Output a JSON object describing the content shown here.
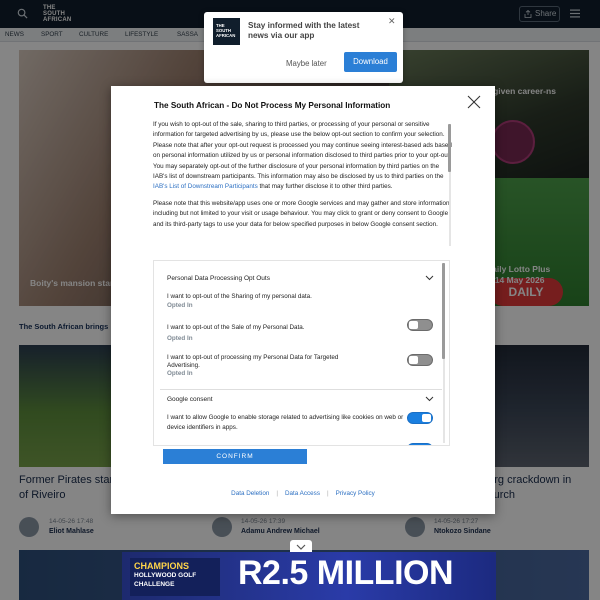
{
  "header": {
    "logo_line1": "THE",
    "logo_line2": "SOUTH",
    "logo_line3": "AFRICAN",
    "share_label": "Share",
    "nav": [
      "NEWS",
      "SPORT",
      "CULTURE",
      "LIFESTYLE",
      "SASSA"
    ]
  },
  "background": {
    "hero_left_caption": "Boity's mansion stars",
    "hero_right_caption": "s given career-ns",
    "lotto_badge": "DAILY LOTTO",
    "hero_right_bottom_caption_1": "Daily Lotto Plus",
    "hero_right_bottom_caption_2": "y, 14 May 2026",
    "bring_text": "The South African brings",
    "cards": [
      {
        "title": "Former Pirates star Ouaddou is doing of Riveiro",
        "time": "14-05-26 17:48",
        "author": "Eliot Mahlase"
      },
      {
        "title": "",
        "time": "14-05-26 17:39",
        "author": "Adamu Andrew Michael"
      },
      {
        "title": "burg crackdown in church",
        "time": "14-05-26 17:27",
        "author": "Ntokozo Sindane"
      }
    ]
  },
  "notification": {
    "title": "Stay informed with the latest news via our app",
    "later_label": "Maybe later",
    "download_label": "Download",
    "logo_line1": "THE",
    "logo_line2": "SOUTH",
    "logo_line3": "AFRICAN"
  },
  "modal": {
    "title": "The South African - Do Not Process My Personal Information",
    "para1_a": "If you wish to opt-out of the sale, sharing to third parties, or processing of your personal or sensitive information for targeted advertising by us, please use the below opt-out section to confirm your selection. Please note that after your opt-out request is processed you may continue seeing interest-based ads based on personal information utilized by us or personal information disclosed to third parties prior to your opt-out. You may separately opt-out of the further disclosure of your personal information by third parties on the IAB's list of downstream participants. This information may also be disclosed by us to third parties on the ",
    "para1_link": "IAB's List of Downstream Participants",
    "para1_b": " that may further disclose it to other third parties.",
    "para2": "Please note that this website/app uses one or more Google services and may gather and store information including but not limited to your visit or usage behaviour. You may click to grant or deny consent to Google and its third-party tags to use your data for below specified purposes in below Google consent section.",
    "section1_title": "Personal Data Processing Opt Outs",
    "opt1_label": "I want to opt-out of the Sharing of my personal data.",
    "opt1_status": "Opted In",
    "opt2_label": "I want to opt-out of the Sale of my Personal Data.",
    "opt2_status": "Opted In",
    "opt3_label": "I want to opt-out of processing my Personal Data for Targeted Advertising.",
    "opt3_status": "Opted In",
    "section2_title": "Google consent",
    "google_label": "I want to allow Google to enable storage related to advertising like cookies on web or device identifiers in apps.",
    "confirm_label": "CONFIRM",
    "footer_links": [
      "Data Deletion",
      "Data Access",
      "Privacy Policy"
    ]
  },
  "ad": {
    "champions": "CHAMPIONS",
    "sub": "HOLLYWOOD GOLF CHALLENGE",
    "amount": "R2.5 MILLION"
  },
  "toggles": {
    "opt1": false,
    "opt2": false,
    "opt3": false,
    "google": true
  }
}
